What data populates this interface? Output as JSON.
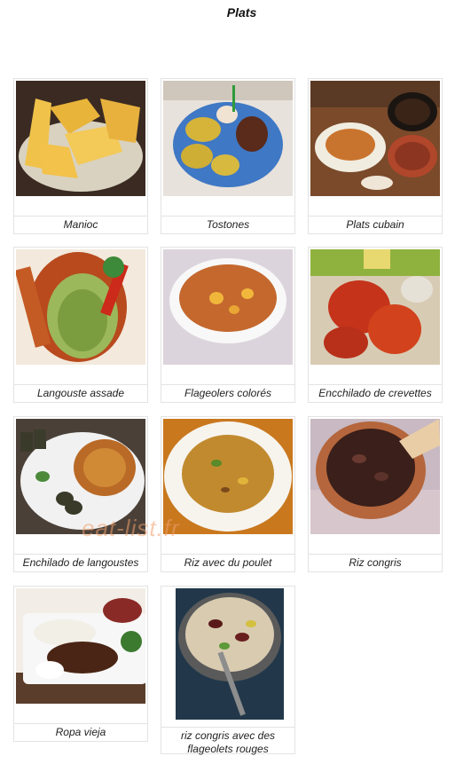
{
  "page": {
    "title": "Plats",
    "watermark": "eat-list.fr"
  },
  "dishes": [
    {
      "name": "Manioc"
    },
    {
      "name": "Tostones"
    },
    {
      "name": "Plats cubain"
    },
    {
      "name": "Langouste assade"
    },
    {
      "name": "Flageolers colorés"
    },
    {
      "name": "Encchilado de crevettes"
    },
    {
      "name": "Enchilado de langoustes"
    },
    {
      "name": "Riz avec du poulet"
    },
    {
      "name": "Riz congris"
    },
    {
      "name": "Ropa vieja"
    },
    {
      "name": "riz congris avec des flageolets rouges"
    }
  ]
}
